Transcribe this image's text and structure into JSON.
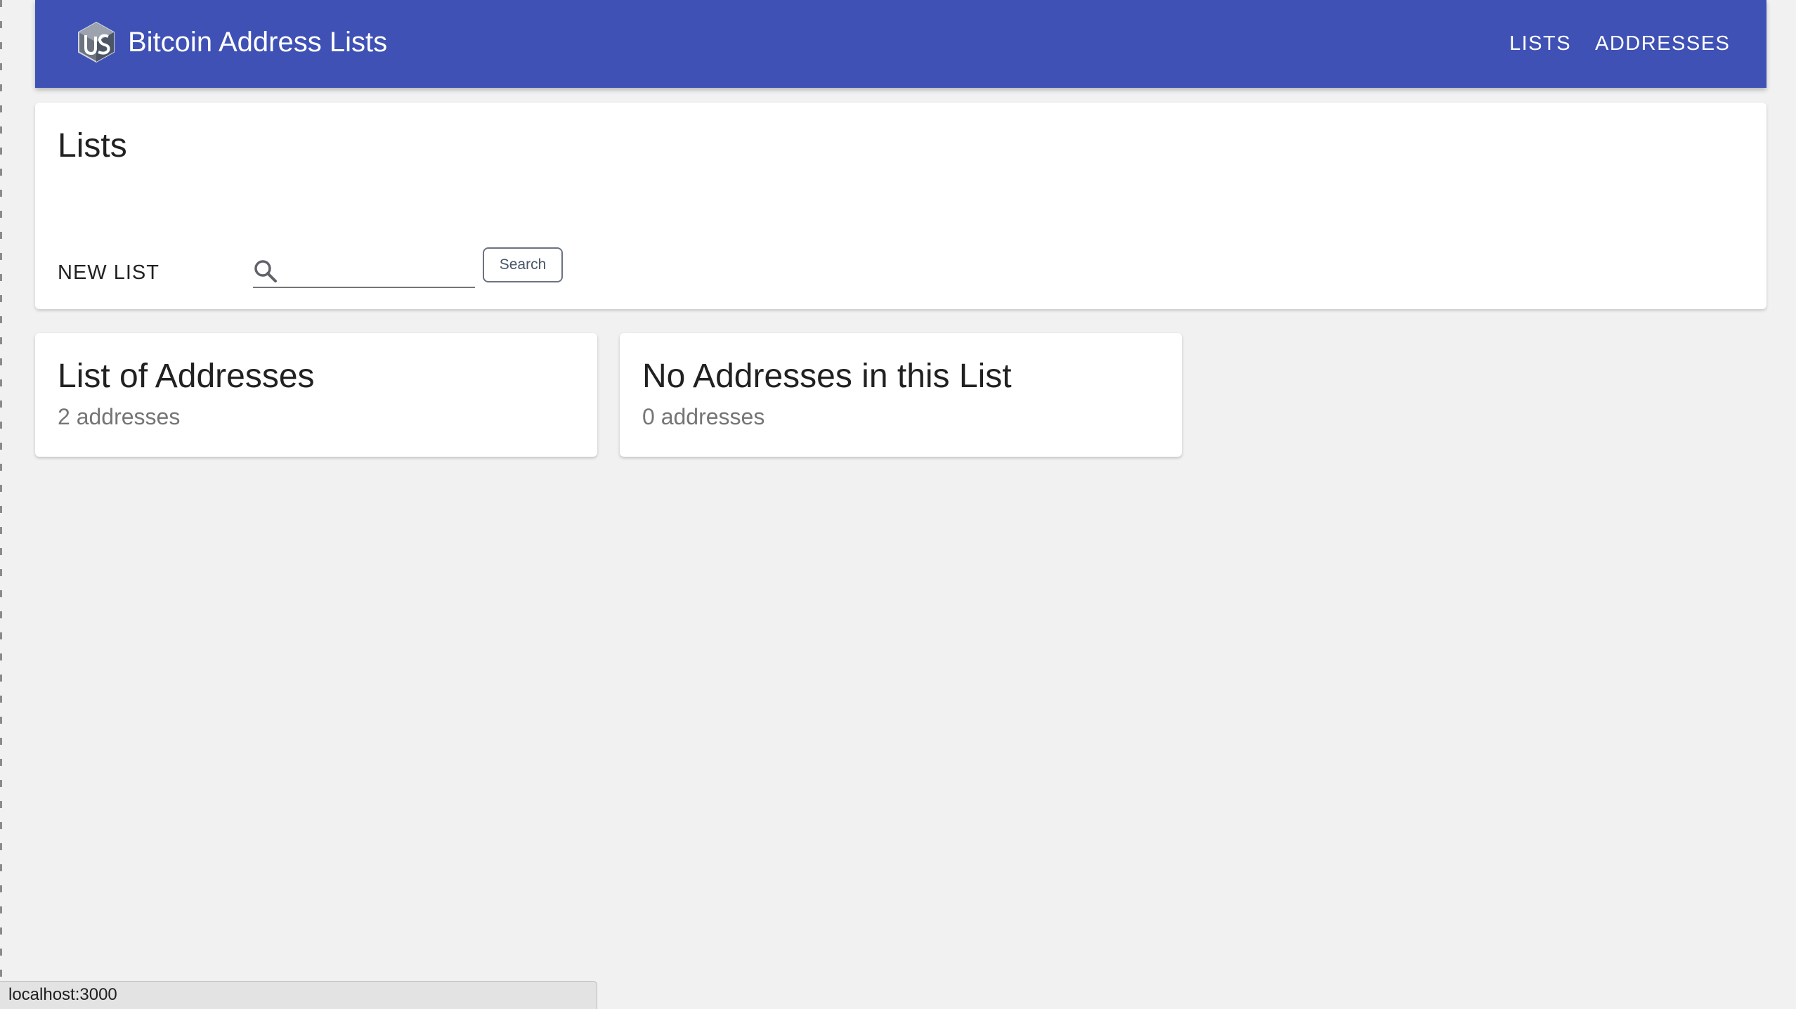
{
  "app": {
    "title": "Bitcoin Address Lists",
    "logo_icon": "cube-logo-icon",
    "brand_color": "#3f51b5"
  },
  "nav": {
    "lists_label": "LISTS",
    "addresses_label": "ADDRESSES"
  },
  "lists_panel": {
    "title": "Lists",
    "new_list_label": "NEW LIST",
    "search": {
      "icon": "search-icon",
      "value": "",
      "placeholder": "",
      "button_label": "Search"
    }
  },
  "cards": [
    {
      "title": "List of Addresses",
      "subtitle": "2 addresses"
    },
    {
      "title": "No Addresses in this List",
      "subtitle": "0 addresses"
    }
  ],
  "status_bar": {
    "url": "localhost:3000"
  }
}
